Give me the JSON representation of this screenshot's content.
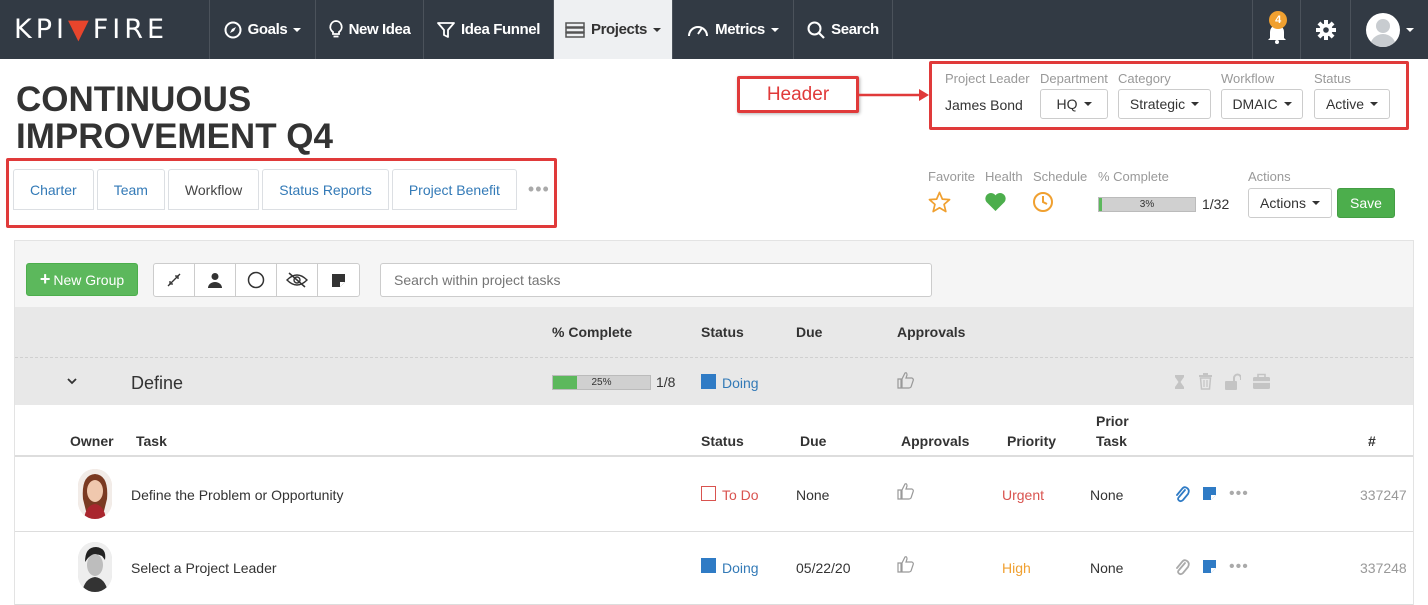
{
  "nav": {
    "logo_left": "KPI",
    "logo_right": "FIRE",
    "goals": "Goals",
    "new_idea": "New Idea",
    "idea_funnel": "Idea Funnel",
    "projects": "Projects",
    "metrics": "Metrics",
    "search": "Search",
    "notification_count": "4"
  },
  "project": {
    "title": "CONTINUOUS IMPROVEMENT Q4"
  },
  "tabs": [
    "Charter",
    "Team",
    "Workflow",
    "Status Reports",
    "Project Benefit"
  ],
  "active_tab": "Workflow",
  "annotation": {
    "label": "Header",
    "color": "#e03a3a"
  },
  "header": {
    "leader_label": "Project Leader",
    "leader_value": "James Bond",
    "department_label": "Department",
    "department_value": "HQ",
    "category_label": "Category",
    "category_value": "Strategic",
    "workflow_label": "Workflow",
    "workflow_value": "DMAIC",
    "status_label": "Status",
    "status_value": "Active"
  },
  "summary": {
    "favorite_label": "Favorite",
    "health_label": "Health",
    "schedule_label": "Schedule",
    "complete_label": "% Complete",
    "complete_percent_text": "3%",
    "complete_fraction": 0.03,
    "complete_count": "1/32",
    "actions_label": "Actions",
    "actions_button": "Actions",
    "save_button": "Save"
  },
  "toolbar": {
    "new_group": "New Group",
    "search_placeholder": "Search within project tasks"
  },
  "group_columns": {
    "complete": "% Complete",
    "status": "Status",
    "due": "Due",
    "approvals": "Approvals"
  },
  "group": {
    "name": "Define",
    "complete_text": "25%",
    "complete_fraction": 0.25,
    "count": "1/8",
    "status": "Doing"
  },
  "task_columns": {
    "owner": "Owner",
    "task": "Task",
    "status": "Status",
    "due": "Due",
    "approvals": "Approvals",
    "priority": "Priority",
    "prior_task_1": "Prior",
    "prior_task_2": "Task",
    "number": "#"
  },
  "tasks": [
    {
      "task": "Define the Problem or Opportunity",
      "status": "To Do",
      "due": "None",
      "priority": "Urgent",
      "prior": "None",
      "number": "337247"
    },
    {
      "task": "Select a Project Leader",
      "status": "Doing",
      "due": "05/22/20",
      "priority": "High",
      "prior": "None",
      "number": "337248"
    }
  ],
  "colors": {
    "nav_bg": "#323a44",
    "link_blue": "#337ab7",
    "green": "#5cb85c",
    "todo_red": "#d9534f",
    "urgent": "#d9534f",
    "high": "#f0a030"
  }
}
